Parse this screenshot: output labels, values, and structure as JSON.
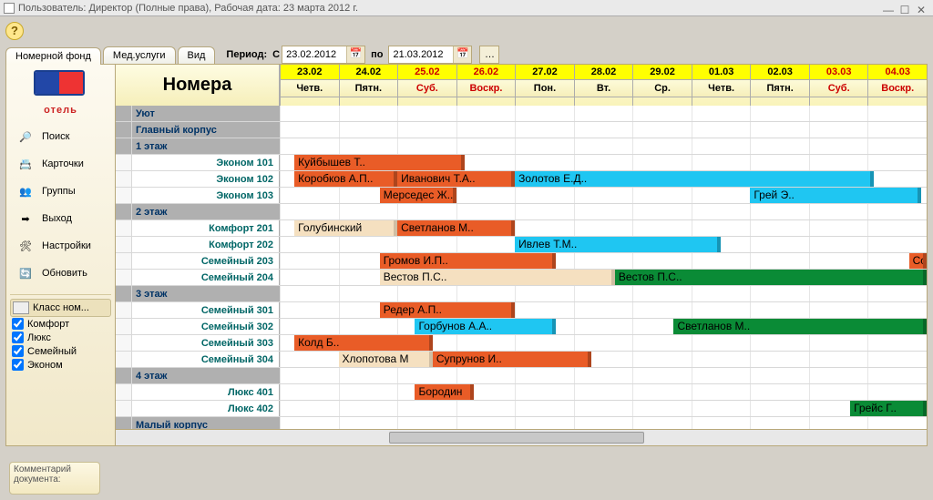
{
  "window": {
    "title": "Пользователь: Директор (Полные права), Рабочая дата: 23 марта 2012 г."
  },
  "tabs": [
    {
      "label": "Номерной фонд",
      "active": true
    },
    {
      "label": "Мед.услуги",
      "active": false
    },
    {
      "label": "Вид",
      "active": false
    }
  ],
  "period": {
    "label": "Период:",
    "from_prefix": "С",
    "from": "23.02.2012",
    "to_prefix": "по",
    "to": "21.03.2012"
  },
  "logo": {
    "text": "отель"
  },
  "sidebar": [
    {
      "name": "poisk",
      "label": "Поиск"
    },
    {
      "name": "kartochki",
      "label": "Карточки"
    },
    {
      "name": "gruppy",
      "label": "Группы"
    },
    {
      "name": "vykhod",
      "label": "Выход"
    },
    {
      "name": "nastroyki",
      "label": "Настройки"
    },
    {
      "name": "obnovit",
      "label": "Обновить"
    }
  ],
  "sidebar_icons": [
    "🔎",
    "📇",
    "👥",
    "➡",
    "🛠",
    "🔄"
  ],
  "filters": {
    "header": "Класс ном...",
    "items": [
      {
        "label": "Комфорт",
        "checked": true
      },
      {
        "label": "Люкс",
        "checked": true
      },
      {
        "label": "Семейный",
        "checked": true
      },
      {
        "label": "Эконом",
        "checked": true
      }
    ]
  },
  "grid": {
    "title": "Номера",
    "days": [
      {
        "date": "23.02",
        "dow": "Четв.",
        "we": false
      },
      {
        "date": "24.02",
        "dow": "Пятн.",
        "we": false
      },
      {
        "date": "25.02",
        "dow": "Суб.",
        "we": true
      },
      {
        "date": "26.02",
        "dow": "Воскр.",
        "we": true
      },
      {
        "date": "27.02",
        "dow": "Пон.",
        "we": false
      },
      {
        "date": "28.02",
        "dow": "Вт.",
        "we": false
      },
      {
        "date": "29.02",
        "dow": "Ср.",
        "we": false
      },
      {
        "date": "01.03",
        "dow": "Четв.",
        "we": false
      },
      {
        "date": "02.03",
        "dow": "Пятн.",
        "we": false
      },
      {
        "date": "03.03",
        "dow": "Суб.",
        "we": true
      },
      {
        "date": "04.03",
        "dow": "Воскр.",
        "we": true
      }
    ],
    "rows": [
      {
        "type": "group",
        "label": "Уют"
      },
      {
        "type": "group",
        "label": "Главный корпус"
      },
      {
        "type": "group",
        "label": "1 этаж"
      },
      {
        "type": "room",
        "label": "Эконом 101",
        "bars": [
          {
            "start": 0.25,
            "span": 2.9,
            "cls": "c-orange",
            "txt": "Куйбышев Т.."
          }
        ]
      },
      {
        "type": "room",
        "label": "Эконом 102",
        "bars": [
          {
            "start": 0.25,
            "span": 1.75,
            "cls": "c-orange",
            "txt": "Коробков А.П.."
          },
          {
            "start": 2,
            "span": 2,
            "cls": "c-orange",
            "txt": "Иванович Т.А.."
          },
          {
            "start": 4,
            "span": 6.1,
            "cls": "c-cyan",
            "txt": "Золотов Е.Д.."
          }
        ]
      },
      {
        "type": "room",
        "label": "Эконом 103",
        "bars": [
          {
            "start": 1.7,
            "span": 1.3,
            "cls": "c-orange",
            "txt": "Мерседес Ж.."
          },
          {
            "start": 8,
            "span": 2.9,
            "cls": "c-cyan",
            "txt": "Грей Э.."
          }
        ]
      },
      {
        "type": "group",
        "label": "2 этаж"
      },
      {
        "type": "room",
        "label": "Комфорт 201",
        "bars": [
          {
            "start": 0.25,
            "span": 1.75,
            "cls": "c-beige",
            "txt": "Голубинский"
          },
          {
            "start": 2,
            "span": 2,
            "cls": "c-orange",
            "txt": "Светланов М.."
          }
        ]
      },
      {
        "type": "room",
        "label": "Комфорт 202",
        "bars": [
          {
            "start": 4,
            "span": 3.5,
            "cls": "c-cyan",
            "txt": "Ивлев Т.М.."
          }
        ]
      },
      {
        "type": "room",
        "label": "Семейный 203",
        "bars": [
          {
            "start": 1.7,
            "span": 3,
            "cls": "c-orange",
            "txt": "Громов И.П.."
          },
          {
            "start": 10.7,
            "span": 0.3,
            "cls": "c-orange",
            "txt": "Сос"
          }
        ]
      },
      {
        "type": "room",
        "label": "Семейный 204",
        "bars": [
          {
            "start": 1.7,
            "span": 4,
            "cls": "c-beige",
            "txt": "Вестов П.С.."
          },
          {
            "start": 5.7,
            "span": 5.3,
            "cls": "c-green",
            "txt": "Вестов П.С.."
          }
        ]
      },
      {
        "type": "group",
        "label": "3 этаж"
      },
      {
        "type": "room",
        "label": "Семейный 301",
        "bars": [
          {
            "start": 1.7,
            "span": 2.3,
            "cls": "c-orange",
            "txt": "Редер А.П.."
          }
        ]
      },
      {
        "type": "room",
        "label": "Семейный 302",
        "bars": [
          {
            "start": 2.3,
            "span": 2.4,
            "cls": "c-cyan",
            "txt": "Горбунов А.А.."
          },
          {
            "start": 6.7,
            "span": 4.3,
            "cls": "c-green",
            "txt": "Светланов М.."
          }
        ]
      },
      {
        "type": "room",
        "label": "Семейный 303",
        "bars": [
          {
            "start": 0.25,
            "span": 2.35,
            "cls": "c-orange",
            "txt": "Колд Б.."
          }
        ]
      },
      {
        "type": "room",
        "label": "Семейный 304",
        "bars": [
          {
            "start": 1,
            "span": 1.6,
            "cls": "c-beige",
            "txt": "Хлопотова М"
          },
          {
            "start": 2.6,
            "span": 2.7,
            "cls": "c-orange",
            "txt": "Супрунов И.."
          }
        ]
      },
      {
        "type": "group",
        "label": "4 этаж"
      },
      {
        "type": "room",
        "label": "Люкс 401",
        "bars": [
          {
            "start": 2.3,
            "span": 1,
            "cls": "c-orange",
            "txt": "Бородин"
          }
        ]
      },
      {
        "type": "room",
        "label": "Люкс 402",
        "bars": [
          {
            "start": 9.7,
            "span": 1.3,
            "cls": "c-green",
            "txt": "Грейс Г.."
          }
        ]
      },
      {
        "type": "group",
        "label": "Малый корпус"
      }
    ]
  },
  "comment": {
    "l1": "Комментарий",
    "l2": "документа:"
  }
}
